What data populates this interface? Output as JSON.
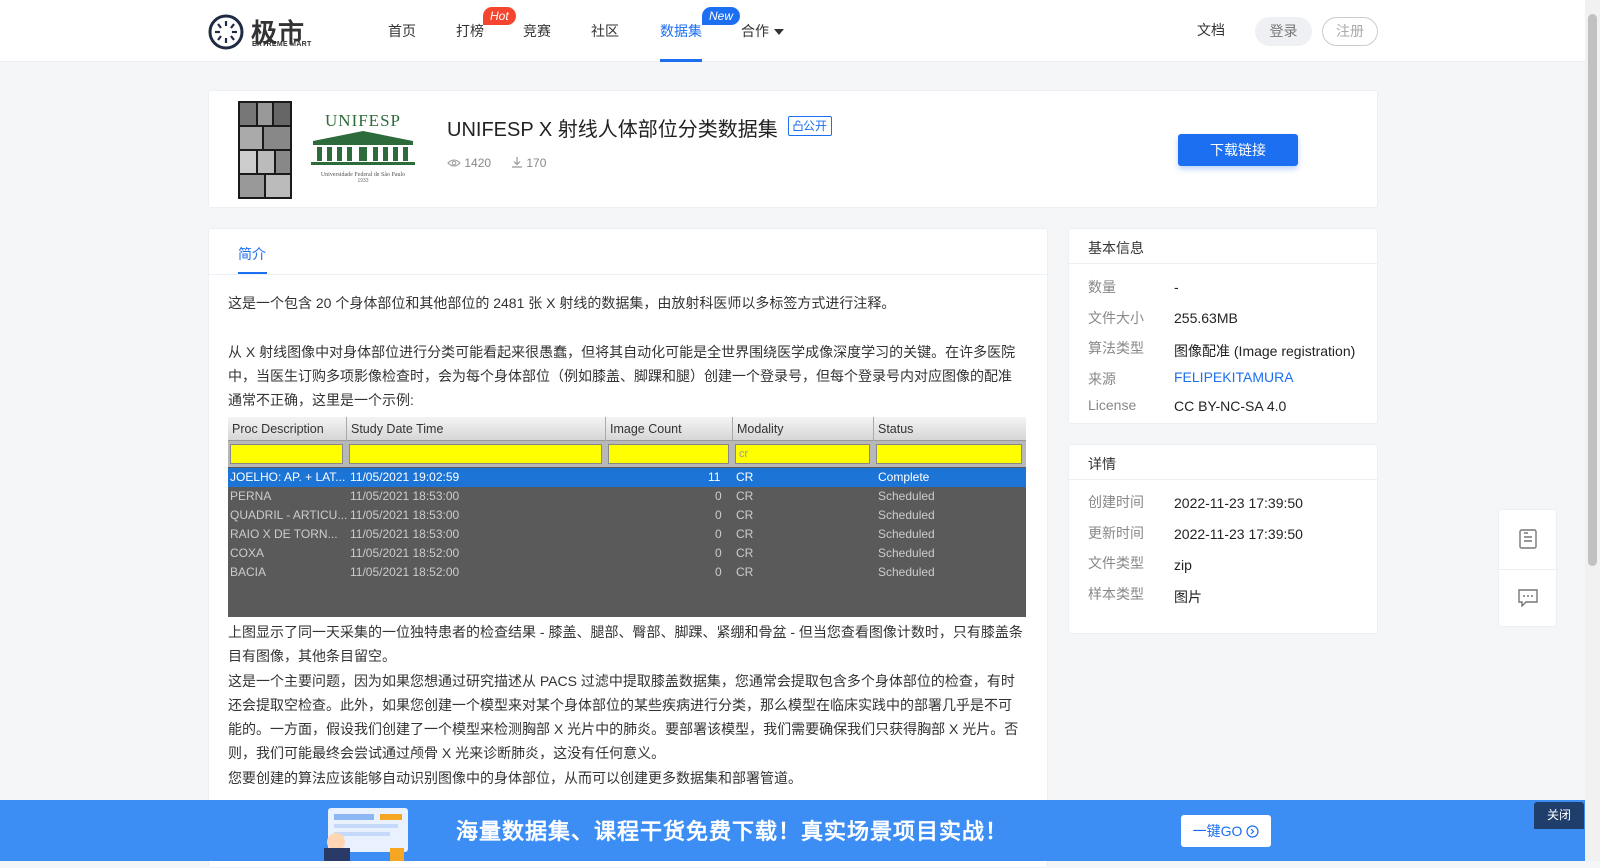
{
  "header": {
    "logo_cn": "极市",
    "logo_en": "EXTREME MART",
    "nav": [
      {
        "label": "首页"
      },
      {
        "label": "打榜",
        "badge": "Hot"
      },
      {
        "label": "竞赛"
      },
      {
        "label": "社区"
      },
      {
        "label": "数据集",
        "badge": "New",
        "active": true
      },
      {
        "label": "合作"
      }
    ],
    "docs": "文档",
    "login": "登录",
    "register": "注册"
  },
  "dataset": {
    "title": "UNIFESP X 射线人体部位分类数据集",
    "visibility": "公开",
    "views": "1420",
    "downloads": "170",
    "download_button": "下载链接",
    "cover_text": "UNIFESP",
    "cover_subtext": "Universidade Federal de São Paulo",
    "cover_year": "1933"
  },
  "intro": {
    "tab": "简介",
    "p1": "这是一个包含 20 个身体部位和其他部位的 2481 张 X 射线的数据集，由放射科医师以多标签方式进行注释。",
    "p2": "从 X 射线图像中对身体部位进行分类可能看起来很愚蠢，但将其自动化可能是全世界围绕医学成像深度学习的关键。在许多医院中，当医生订购多项影像检查时，会为每个身体部位（例如膝盖、脚踝和腿）创建一个登录号，但每个登录号内对应图像的配准通常不正确，这里是一个示例:",
    "p3": "上图显示了同一天采集的一位独特患者的检查结果 - 膝盖、腿部、臀部、脚踝、紧绷和骨盆 - 但当您查看图像计数时，只有膝盖条目有图像，其他条目留空。",
    "p4": "这是一个主要问题，因为如果您想通过研究描述从 PACS 过滤中提取膝盖数据集，您通常会提取包含多个身体部位的检查，有时还会提取空检查。此外，如果您创建一个模型来对某个身体部位的某些疾病进行分类，那么模型在临床实践中的部署几乎是不可能的。一方面，假设我们创建了一个模型来检测胸部 X 光片中的肺炎。要部署该模型，我们需要确保我们只获得胸部 X 光片。否则，我们可能最终会尝试通过颅骨 X 光来诊断肺炎，这没有任何意义。",
    "p5": "您要创建的算法应该能够自动识别图像中的身体部位，从而可以创建更多数据集和部署管道。"
  },
  "example_table": {
    "headers": [
      "Proc Description",
      "Study Date Time",
      "Image Count",
      "Modality",
      "Status"
    ],
    "filter_modality": "cr",
    "rows": [
      [
        "JOELHO: AP. + LAT...",
        "11/05/2021 19:02:59",
        "11",
        "CR",
        "Complete"
      ],
      [
        "PERNA",
        "11/05/2021 18:53:00",
        "0",
        "CR",
        "Scheduled"
      ],
      [
        "QUADRIL - ARTICU...",
        "11/05/2021 18:53:00",
        "0",
        "CR",
        "Scheduled"
      ],
      [
        "RAIO X DE TORN...",
        "11/05/2021 18:53:00",
        "0",
        "CR",
        "Scheduled"
      ],
      [
        "COXA",
        "11/05/2021 18:52:00",
        "0",
        "CR",
        "Scheduled"
      ],
      [
        "BACIA",
        "11/05/2021 18:52:00",
        "0",
        "CR",
        "Scheduled"
      ]
    ]
  },
  "basic_info": {
    "title": "基本信息",
    "items": [
      {
        "k": "数量",
        "v": "-"
      },
      {
        "k": "文件大小",
        "v": "255.63MB"
      },
      {
        "k": "算法类型",
        "v": "图像配准 (Image registration)"
      },
      {
        "k": "来源",
        "v": "FELIPEKITAMURA"
      },
      {
        "k": "License",
        "v": "CC BY-NC-SA 4.0"
      }
    ]
  },
  "details": {
    "title": "详情",
    "items": [
      {
        "k": "创建时间",
        "v": "2022-11-23 17:39:50"
      },
      {
        "k": "更新时间",
        "v": "2022-11-23 17:39:50"
      },
      {
        "k": "文件类型",
        "v": "zip"
      },
      {
        "k": "样本类型",
        "v": "图片"
      }
    ]
  },
  "banner": {
    "text": "海量数据集、课程干货免费下载！真实场景项目实战！",
    "button": "一键GO",
    "close": "关闭"
  },
  "colors": {
    "accent": "#1d6ff2",
    "hot_badge": "#f5452e",
    "new_badge": "#1d6ff2",
    "banner": "#3d8ef4"
  }
}
